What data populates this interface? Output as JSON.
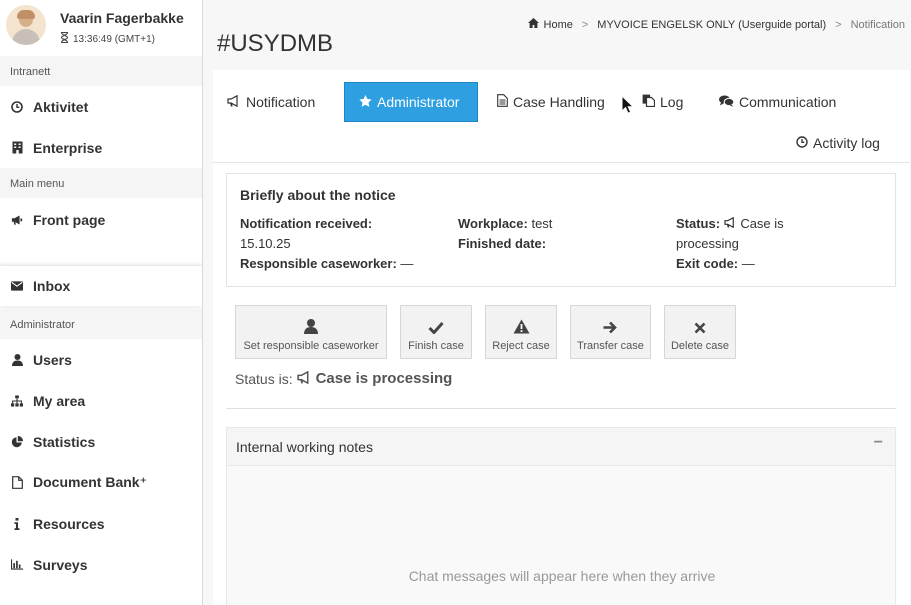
{
  "user": {
    "name": "Vaarin Fagerbakke",
    "time": "13:36:49 (GMT+1)"
  },
  "sidebar": {
    "section_intranet": "Intranett",
    "intranet_items": [
      {
        "label": "Aktivitet",
        "icon": "clock-icon"
      },
      {
        "label": "Enterprise",
        "icon": "building-icon"
      }
    ],
    "section_main": "Main menu",
    "main_items": [
      {
        "label": "Front page",
        "icon": "bullhorn-icon"
      }
    ],
    "inbox": {
      "label": "Inbox",
      "icon": "envelope-icon"
    },
    "section_admin": "Administrator",
    "admin_items": [
      {
        "label": "Users",
        "icon": "user-icon"
      },
      {
        "label": "My area",
        "icon": "sitemap-icon"
      },
      {
        "label": "Statistics",
        "icon": "pie-chart-icon"
      },
      {
        "label": "Document Bank⁺",
        "icon": "file-icon"
      },
      {
        "label": "Resources",
        "icon": "info-icon"
      },
      {
        "label": "Surveys",
        "icon": "bar-chart-icon"
      }
    ]
  },
  "breadcrumb": {
    "home": "Home",
    "portal": "MYVOICE ENGELSK ONLY (Userguide portal)",
    "current": "Notification"
  },
  "case": {
    "id": "#USYDMB"
  },
  "tabs": [
    {
      "label": "Notification",
      "icon": "bullhorn-icon"
    },
    {
      "label": "Administrator",
      "icon": "star-icon",
      "active": true
    },
    {
      "label": "Case Handling",
      "icon": "file-text-icon"
    },
    {
      "label": "Log",
      "icon": "copy-icon"
    },
    {
      "label": "Communication",
      "icon": "comments-icon"
    },
    {
      "label": "Activity log",
      "icon": "clock-icon"
    }
  ],
  "notice": {
    "title": "Briefly about the notice",
    "received_label": "Notification received:",
    "received_value": "15.10.25",
    "responsible_label": "Responsible caseworker:",
    "responsible_value": "—",
    "workplace_label": "Workplace:",
    "workplace_value": "test",
    "finished_label": "Finished date:",
    "status_label": "Status:",
    "status_value_1": "Case is",
    "status_value_2": "processing",
    "exit_label": "Exit code:",
    "exit_value": "—"
  },
  "actions": [
    {
      "label": "Set responsible caseworker",
      "icon": "user-icon"
    },
    {
      "label": "Finish case",
      "icon": "check-icon"
    },
    {
      "label": "Reject case",
      "icon": "warning-icon"
    },
    {
      "label": "Transfer case",
      "icon": "arrow-right-icon"
    },
    {
      "label": "Delete case",
      "icon": "close-icon"
    }
  ],
  "status_line": {
    "prefix": "Status is:",
    "value": "Case is processing"
  },
  "notes": {
    "title": "Internal working notes",
    "toggle": "−",
    "empty": "Chat messages will appear here when they arrive"
  },
  "colors": {
    "active_tab": "#2e9fe0",
    "sidebar_section_bg": "#f5f5f5",
    "main_bg": "#f7f7f7"
  }
}
